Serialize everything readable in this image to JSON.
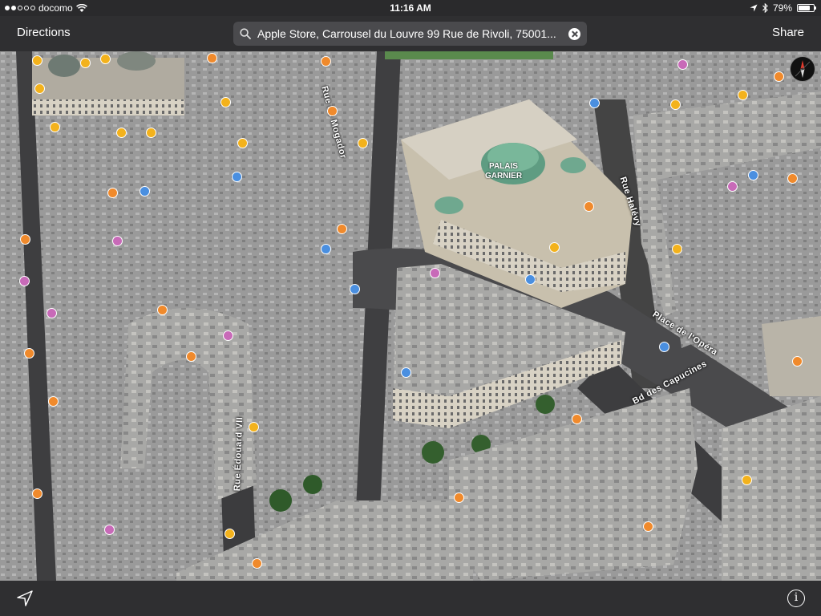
{
  "status_bar": {
    "carrier": "docomo",
    "time": "11:16 AM",
    "battery": "79%",
    "battery_level": 0.79
  },
  "nav": {
    "directions_label": "Directions",
    "share_label": "Share",
    "search_value": "Apple Store, Carrousel du Louvre 99 Rue de Rivoli, 75001..."
  },
  "map": {
    "landmark_label": "PALAIS GARNIER",
    "streets": {
      "rue_de_mogador": "Rue de Mogador",
      "rue_halevy": "Rue Halévy",
      "place_de_lopera": "Place de l'Opéra",
      "bd_des_capucines": "Bd des Capucines",
      "rue_edouard_vii": "Rue Édouard VII"
    },
    "colors": {
      "poi_food": "#f08a2c",
      "poi_shop": "#f3b21c",
      "poi_culture": "#c86ab8",
      "poi_transit": "#4a8fe0",
      "roof_green": "#6fa88f"
    }
  },
  "toolbar": {
    "info_label": "i"
  }
}
